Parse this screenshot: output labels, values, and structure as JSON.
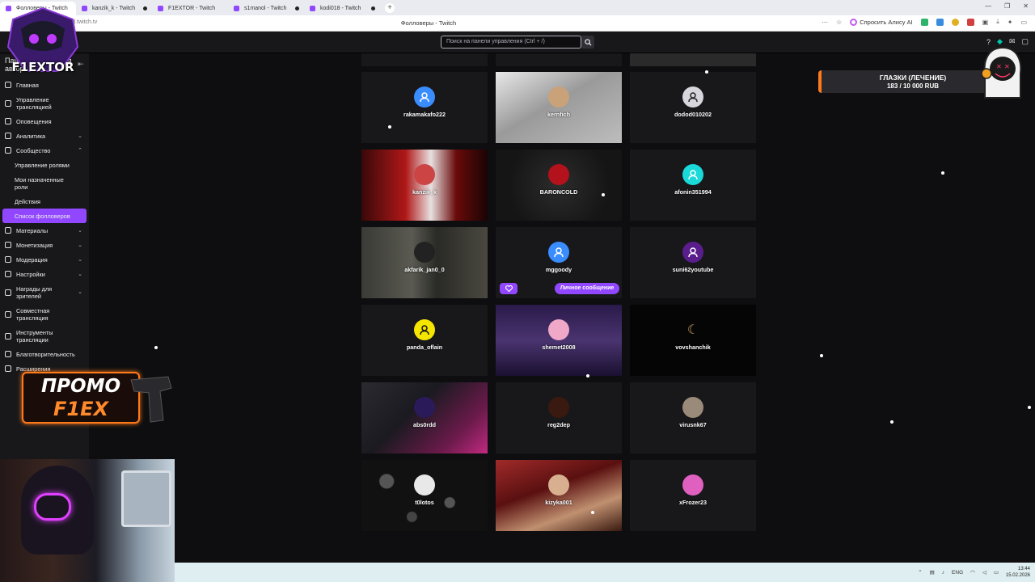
{
  "browser": {
    "tabs": [
      {
        "label": "Фолловеры - Twitch",
        "active": true
      },
      {
        "label": "kanzik_k - Twitch"
      },
      {
        "label": "F1EXTOR - Twitch"
      },
      {
        "label": "s1manol - Twitch"
      },
      {
        "label": "kodi018 - Twitch"
      }
    ],
    "new_tab": "+",
    "url": "dashboard.twitch.tv",
    "page_title": "Фолловеры - Twitch",
    "alice_button": "Спросить Алису AI"
  },
  "topnav": {
    "search_placeholder": "Поиск на панели управления (Ctrl + /)"
  },
  "sidebar": {
    "header": "Панель управления автора",
    "items": [
      {
        "label": "Главная",
        "icon": "home-icon"
      },
      {
        "label": "Управление трансляцией",
        "icon": "broadcast-icon"
      },
      {
        "label": "Оповещения",
        "icon": "bell-icon"
      },
      {
        "label": "Аналитика",
        "icon": "chart-icon",
        "chevron": "down"
      },
      {
        "label": "Сообщество",
        "icon": "community-icon",
        "chevron": "up"
      },
      {
        "label": "Управление ролями",
        "sub": true
      },
      {
        "label": "Мои назначенные роли",
        "sub": true
      },
      {
        "label": "Действия",
        "sub": true
      },
      {
        "label": "Список фолловеров",
        "sub": true,
        "active": true
      },
      {
        "label": "Материалы",
        "icon": "content-icon",
        "chevron": "down"
      },
      {
        "label": "Монетизация",
        "icon": "money-icon",
        "chevron": "down"
      },
      {
        "label": "Модерация",
        "icon": "shield-icon",
        "chevron": "down"
      },
      {
        "label": "Настройки",
        "icon": "gear-icon",
        "chevron": "down"
      },
      {
        "label": "Награды для зрителей",
        "icon": "reward-icon",
        "chevron": "down"
      },
      {
        "label": "Совместная трансляция",
        "icon": "collab-icon"
      },
      {
        "label": "Инструменты трансляции",
        "icon": "tools-icon"
      },
      {
        "label": "Благотворительность",
        "icon": "charity-icon"
      },
      {
        "label": "Расширения",
        "icon": "extensions-icon"
      }
    ]
  },
  "overlay": {
    "logo_text": "F1EXTOR",
    "promo_line1": "ПРОМО",
    "promo_line2": "F1EX",
    "goal_title": "ГЛАЗКИ (ЛЕЧЕНИЕ)",
    "goal_progress": "183 / 10 000 RUB",
    "goal_current": 183,
    "goal_target": 10000
  },
  "followers": [
    {
      "name": "rakamakafo222",
      "avatar": "default-blue"
    },
    {
      "name": "kernfich",
      "avatar": "photo"
    },
    {
      "name": "dodod010202",
      "avatar": "default-gray"
    },
    {
      "name": "kanzik_k",
      "avatar": "photo"
    },
    {
      "name": "BARONCOLD",
      "avatar": "photo"
    },
    {
      "name": "afonin351994",
      "avatar": "default-cyan"
    },
    {
      "name": "akfarik_jan0_0",
      "avatar": "photo"
    },
    {
      "name": "mggoody",
      "avatar": "default-blue"
    },
    {
      "name": "suni62youtube",
      "avatar": "default-purple"
    },
    {
      "name": "panda_oflain",
      "avatar": "default-yellow"
    },
    {
      "name": "shemet2008",
      "avatar": "photo"
    },
    {
      "name": "vovshanchik",
      "avatar": "photo"
    },
    {
      "name": "abs0rdd",
      "avatar": "photo"
    },
    {
      "name": "reg2dep",
      "avatar": "photo"
    },
    {
      "name": "virusnk67",
      "avatar": "photo"
    },
    {
      "name": "t0lotos",
      "avatar": "photo"
    },
    {
      "name": "kizyka001",
      "avatar": "photo"
    },
    {
      "name": "xFrozer23",
      "avatar": "photo"
    }
  ],
  "hover_actions": {
    "dm_label": "Личное сообщение"
  },
  "taskbar": {
    "lang": "ENG",
    "time": "13:44",
    "date": "15.02.2026"
  },
  "colors": {
    "accent": "#9147ff",
    "promo": "#ff7a1a",
    "background": "#0e0e10"
  }
}
